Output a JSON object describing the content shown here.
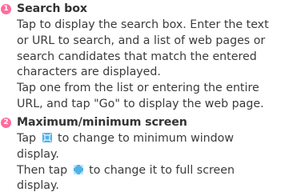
{
  "items": [
    {
      "number": "1",
      "title": "Search box",
      "lines": [
        "Tap to display the search box. Enter the text",
        "or URL to search, and a list of web pages or",
        "search candidates that match the entered",
        "characters are displayed.",
        "Tap one from the list or entering the entire",
        "URL, and tap \"Go\" to display the web page."
      ]
    },
    {
      "number": "2",
      "title": "Maximum/minimum screen",
      "line1_before": "Tap",
      "line1_after": "to change to minimum window",
      "line2": "display.",
      "line3_before": "Then tap",
      "line3_after": "to change it to full screen",
      "line4": "display.",
      "icons": {
        "minimize": "minimize-window-icon",
        "maximize": "maximize-window-icon"
      }
    }
  ],
  "colors": {
    "badge": "#ff6c9c",
    "icon": "#4fb2e8",
    "text": "#3a3a3a"
  }
}
